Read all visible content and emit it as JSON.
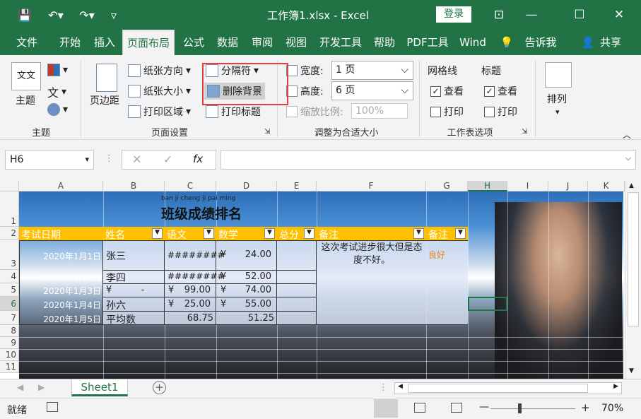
{
  "window": {
    "title": "工作簿1.xlsx  -  Excel",
    "login_label": "登录",
    "icons": [
      "save-icon",
      "undo-icon",
      "redo-icon",
      "customize-qat-icon"
    ]
  },
  "tabs": [
    "文件",
    "开始",
    "插入",
    "页面布局",
    "公式",
    "数据",
    "审阅",
    "视图",
    "开发工具",
    "帮助",
    "PDF工具",
    "Wind",
    "告诉我",
    "共享"
  ],
  "active_tab": "页面布局",
  "ribbon": {
    "theme_group": {
      "label": "主题",
      "theme_btn": "主题"
    },
    "page_setup_group": {
      "label": "页面设置",
      "margins": "页边距",
      "orientation": "纸张方向",
      "size": "纸张大小",
      "print_area": "打印区域",
      "breaks": "分隔符",
      "delete_background": "删除背景",
      "print_titles": "打印标题"
    },
    "scale_group": {
      "label": "调整为合适大小",
      "width_label": "宽度:",
      "width_value": "1 页",
      "height_label": "高度:",
      "height_value": "6 页",
      "scale_label": "缩放比例:",
      "scale_value": "100%"
    },
    "sheet_options_group": {
      "label": "工作表选项",
      "gridlines": "网格线",
      "headings": "标题",
      "view": "查看",
      "print": "打印"
    },
    "arrange_group": {
      "label": "排列"
    }
  },
  "formula_bar": {
    "name_box": "H6",
    "fx": "fx",
    "value": ""
  },
  "columns": [
    "A",
    "B",
    "C",
    "D",
    "E",
    "F",
    "G",
    "H",
    "I",
    "J",
    "K"
  ],
  "rows": [
    "1",
    "2",
    "3",
    "4",
    "5",
    "6",
    "7",
    "8",
    "9",
    "10",
    "11"
  ],
  "sheet": {
    "title_pinyin": "ban ji cheng ji pai ming",
    "title": "班级成绩排名",
    "headers": [
      "考试日期",
      "姓名",
      "语文",
      "数学",
      "总分",
      "备注",
      "备注"
    ],
    "rows": [
      {
        "date": "2020年1月1日",
        "name": "张三",
        "chinese": "########",
        "math_sym": "¥",
        "math": "24.00",
        "note": "这次考试进步很大但是态度不好。",
        "remark": "良好"
      },
      {
        "date": "2020年1月2日",
        "name": "李四",
        "chinese": "########",
        "math_sym": "¥",
        "math": "52.00"
      },
      {
        "date": "2020年1月3日",
        "name": "¥          -",
        "chinese_sym": "¥",
        "chinese": "99.00",
        "math_sym": "¥",
        "math": "74.00"
      },
      {
        "date": "2020年1月4日",
        "name": "孙六",
        "chinese_sym": "¥",
        "chinese": "25.00",
        "math_sym": "¥",
        "math": "55.00"
      },
      {
        "date": "2020年1月5日",
        "name": "平均数",
        "chinese": "68.75",
        "math": "51.25"
      }
    ]
  },
  "sheet_tab": "Sheet1",
  "status": {
    "ready": "就绪",
    "zoom": "70%"
  }
}
